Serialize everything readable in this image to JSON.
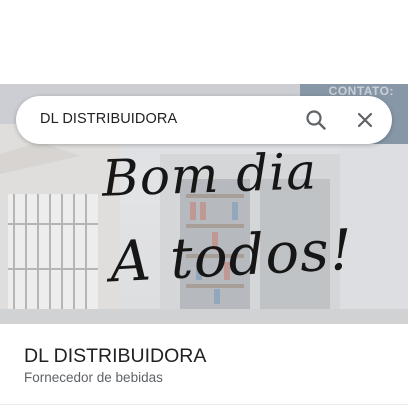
{
  "search": {
    "query": "DL DISTRIBUIDORA",
    "search_icon": "search-icon",
    "clear_icon": "close-icon"
  },
  "hero": {
    "line1": "Bom dia",
    "line2": "A todos!",
    "sign": "CONTATO:"
  },
  "place": {
    "name": "DL DISTRIBUIDORA",
    "category": "Fornecedor de bebidas"
  },
  "colors": {
    "text_primary": "#202124",
    "text_secondary": "#5f6368",
    "icon": "#5f6368"
  }
}
